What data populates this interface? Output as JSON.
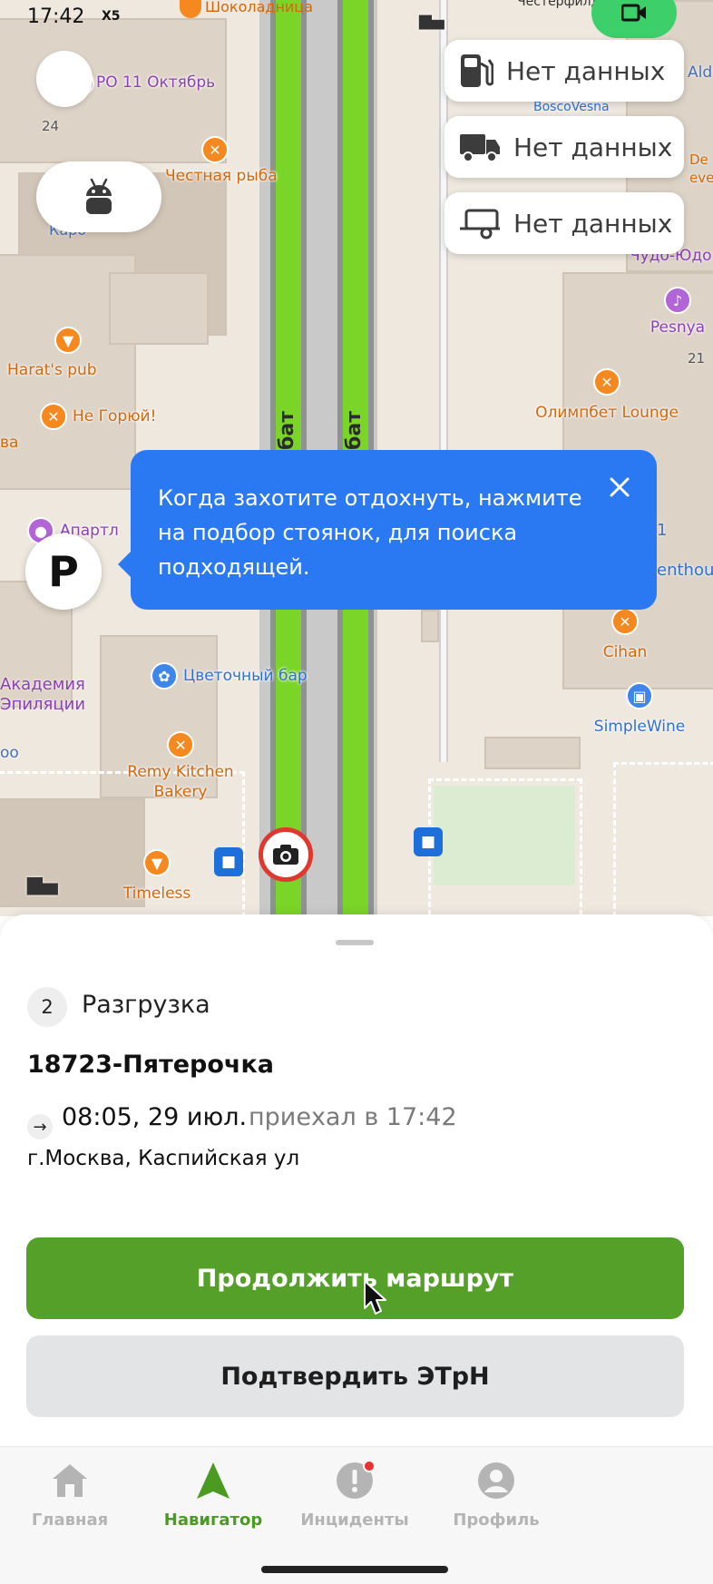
{
  "status_bar": {
    "time": "17:42",
    "carrier_badge": "X5",
    "top_poi": "Шоколадница",
    "top_right_poi": "Честерфилд"
  },
  "map": {
    "road_name": "бат",
    "district_numbers": [
      "24",
      "21"
    ],
    "pois": [
      {
        "label": "РО 11 Октябрь",
        "icon": "film-icon"
      },
      {
        "label": "Честная рыба",
        "icon": "food-icon"
      },
      {
        "label": "Каро",
        "icon": ""
      },
      {
        "label": "Harat's pub",
        "icon": "drink-icon"
      },
      {
        "label": "Не Горюй!",
        "icon": "food-icon"
      },
      {
        "label": "ва",
        "icon": ""
      },
      {
        "label": "Апартл",
        "icon": "hotel-icon"
      },
      {
        "label": "Академия\nЭпиляции",
        "icon": ""
      },
      {
        "label": "оо",
        "icon": ""
      },
      {
        "label": "Цветочный бар",
        "icon": "flower-icon"
      },
      {
        "label": "Remy Kitchen\nBakery",
        "icon": "food-icon"
      },
      {
        "label": "Timeless",
        "icon": "drink-icon"
      },
      {
        "label": "Ald",
        "icon": ""
      },
      {
        "label": "BoscoVesna",
        "icon": ""
      },
      {
        "label": "De\never",
        "icon": ""
      },
      {
        "label": "Чудо-Юдо",
        "icon": ""
      },
      {
        "label": "Pesnya",
        "icon": "music-icon"
      },
      {
        "label": "Олимпбет Lounge",
        "icon": "food-icon"
      },
      {
        "label": "1",
        "icon": ""
      },
      {
        "label": "enthou",
        "icon": ""
      },
      {
        "label": "Cihan",
        "icon": "food-icon"
      },
      {
        "label": "SimpleWine",
        "icon": "shop-icon"
      }
    ],
    "info_pills": [
      {
        "icon": "fuel-icon",
        "label": "Нет данных"
      },
      {
        "icon": "truck-icon",
        "label": "Нет данных"
      },
      {
        "icon": "trailer-icon",
        "label": "Нет данных"
      }
    ],
    "parking_label": "P",
    "tooltip": {
      "text": "Когда захотите отдохнуть, нажмите на подбор стоянок, для поиска подходящей."
    }
  },
  "sheet": {
    "step_number": "2",
    "step_title": "Разгрузка",
    "stop_name": "18723-Пятерочка",
    "arrival_time": "08:05, 29 июл.",
    "arrival_note": "приехал в 17:42",
    "address": "г.Москва, Каспийская ул",
    "continue_label": "Продолжить маршрут",
    "confirm_label": "Подтвердить ЭТрН"
  },
  "nav": {
    "items": [
      {
        "label": "Главная",
        "icon": "home-icon",
        "active": false
      },
      {
        "label": "Навигатор",
        "icon": "navigation-arrow-icon",
        "active": true
      },
      {
        "label": "Инциденты",
        "icon": "alert-icon",
        "active": false
      },
      {
        "label": "Профиль",
        "icon": "profile-icon",
        "active": false
      }
    ]
  },
  "colors": {
    "primary_green": "#55a028",
    "active_nav": "#4b9a22",
    "tooltip_blue": "#2b79f2",
    "route_green": "#7bd428",
    "video_green": "#3ccf6a",
    "notification_red": "#ec3030"
  }
}
